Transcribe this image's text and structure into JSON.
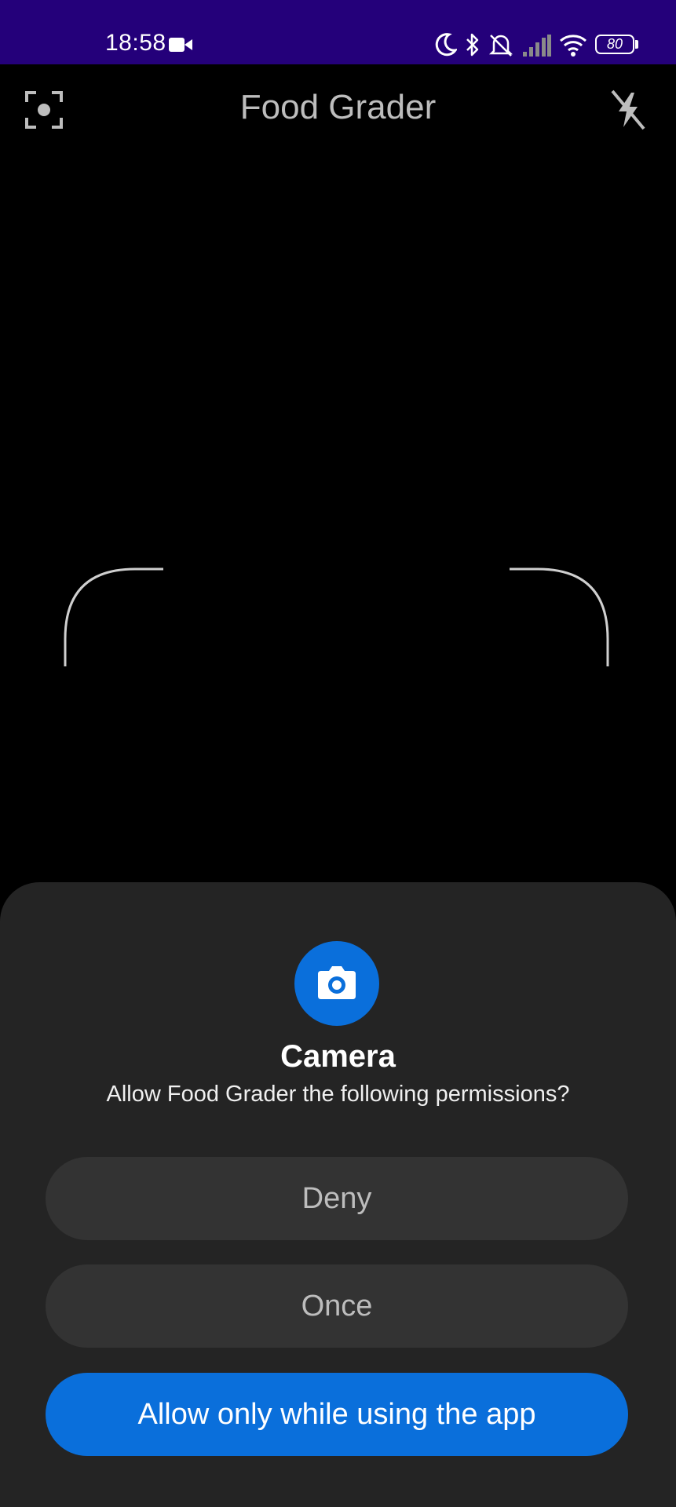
{
  "status_bar": {
    "time": "18:58",
    "battery": "80",
    "background_color": "#24007a",
    "icons": [
      "video-camera-icon",
      "moon-icon",
      "bluetooth-icon",
      "mute-icon",
      "signal-icon",
      "wifi-icon",
      "battery-icon"
    ]
  },
  "app_bar": {
    "title": "Food Grader",
    "left_icon": "scan-icon",
    "right_icon": "flash-off-icon"
  },
  "permission_dialog": {
    "icon": "camera-icon",
    "title": "Camera",
    "message": "Allow Food Grader the following permissions?",
    "buttons": {
      "deny": "Deny",
      "once": "Once",
      "allow": "Allow only while using the app"
    },
    "accent_color": "#0a6fdb"
  }
}
